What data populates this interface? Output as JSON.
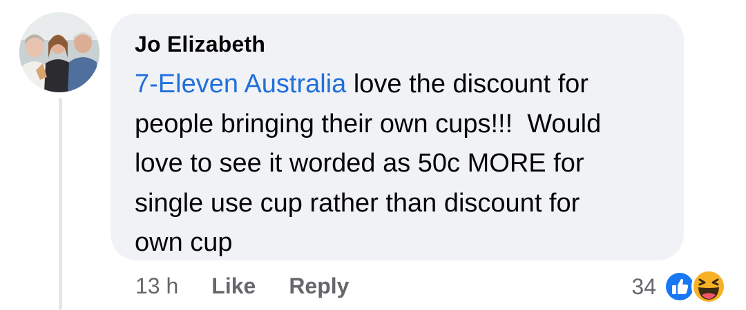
{
  "comment": {
    "author": "Jo Elizabeth",
    "mention": "7-Eleven Australia",
    "lines": [
      " love the discount for",
      "people bringing their own cups!!!  Would",
      "love to see it worded as 50c MORE for",
      "single use cup rather than discount for",
      "own cup"
    ]
  },
  "meta": {
    "time": "13 h",
    "like_label": "Like",
    "reply_label": "Reply"
  },
  "reactions": {
    "count": "34",
    "icons": [
      "like-icon",
      "haha-icon"
    ]
  },
  "colors": {
    "bubble": "#f0f2f5",
    "mention": "#216fdb",
    "meta_text": "#65676b",
    "like_blue": "#1877f2",
    "haha_yellow": "#f7b125"
  }
}
